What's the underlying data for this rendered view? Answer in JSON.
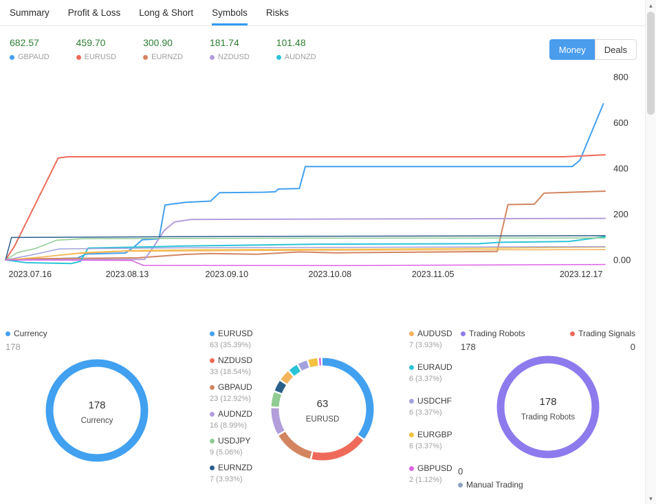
{
  "tabs": {
    "items": [
      {
        "label": "Summary",
        "active": false
      },
      {
        "label": "Profit & Loss",
        "active": false
      },
      {
        "label": "Long & Short",
        "active": false
      },
      {
        "label": "Symbols",
        "active": true
      },
      {
        "label": "Risks",
        "active": false
      }
    ]
  },
  "toolbar": {
    "money_label": "Money",
    "deals_label": "Deals",
    "active": "Money"
  },
  "top_legend": [
    {
      "value": "682.57",
      "label": "GBPAUD",
      "color": "#41a0f0"
    },
    {
      "value": "459.70",
      "label": "EURUSD",
      "color": "#ef6a5a"
    },
    {
      "value": "300.90",
      "label": "EURNZD",
      "color": "#d2855f"
    },
    {
      "value": "181.74",
      "label": "NZDUSD",
      "color": "#b39ddb"
    },
    {
      "value": "101.48",
      "label": "AUDNZD",
      "color": "#2bc3d7"
    }
  ],
  "colors": {
    "accent_blue": "#4a9ced",
    "positive_green": "#2e7d32",
    "tab_underline": "#2f9bf4"
  },
  "chart_data": [
    {
      "type": "line",
      "title": "Symbols cumulative profit (Money)",
      "legend_position": "top",
      "grid": false,
      "y_axis_position": "right",
      "y_range": [
        -60,
        820
      ],
      "y_ticks": [
        {
          "value": 800,
          "label": "800"
        },
        {
          "value": 600,
          "label": "600"
        },
        {
          "value": 400,
          "label": "400"
        },
        {
          "value": 200,
          "label": "200"
        },
        {
          "value": 0,
          "label": "0.00"
        }
      ],
      "x_tick_labels": [
        {
          "text": "2023.07.16",
          "frac": 0.041
        },
        {
          "text": "2023.08.13",
          "frac": 0.203
        },
        {
          "text": "2023.09.10",
          "frac": 0.369
        },
        {
          "text": "2023.10.08",
          "frac": 0.541
        },
        {
          "text": "2023.11.05",
          "frac": 0.713
        },
        {
          "text": "2023.12.17",
          "frac": 0.96
        }
      ],
      "series": [
        {
          "name": "GBPAUD",
          "color": "#41a0f0",
          "width": 2,
          "final": 682.57,
          "points": [
            [
              0,
              0
            ],
            [
              0.05,
              3
            ],
            [
              0.12,
              8
            ],
            [
              0.135,
              26
            ],
            [
              0.2,
              30
            ],
            [
              0.215,
              58
            ],
            [
              0.228,
              88
            ],
            [
              0.256,
              92
            ],
            [
              0.266,
              240
            ],
            [
              0.3,
              252
            ],
            [
              0.342,
              257
            ],
            [
              0.357,
              294
            ],
            [
              0.43,
              296
            ],
            [
              0.45,
              298
            ],
            [
              0.455,
              310
            ],
            [
              0.49,
              312
            ],
            [
              0.5,
              408
            ],
            [
              0.945,
              408
            ],
            [
              0.958,
              436
            ],
            [
              0.997,
              682.57
            ]
          ]
        },
        {
          "name": "EURUSD",
          "color": "#ef6a5a",
          "width": 2,
          "final": 459.7,
          "points": [
            [
              0,
              0
            ],
            [
              0.015,
              60
            ],
            [
              0.088,
              446
            ],
            [
              0.105,
              451
            ],
            [
              0.93,
              451
            ],
            [
              1.0,
              459.7
            ]
          ]
        },
        {
          "name": "EURNZD",
          "color": "#d2855f",
          "width": 2,
          "final": 300.9,
          "points": [
            [
              0,
              0
            ],
            [
              0.05,
              5
            ],
            [
              0.22,
              9
            ],
            [
              0.3,
              24
            ],
            [
              0.34,
              28
            ],
            [
              0.42,
              25
            ],
            [
              0.49,
              35
            ],
            [
              0.55,
              31
            ],
            [
              0.82,
              37
            ],
            [
              0.838,
              242
            ],
            [
              0.882,
              244
            ],
            [
              0.898,
              292
            ],
            [
              1.0,
              300.9
            ]
          ]
        },
        {
          "name": "NZDUSD",
          "color": "#b39ddb",
          "width": 2,
          "final": 181.74,
          "points": [
            [
              0,
              0
            ],
            [
              0.232,
              2
            ],
            [
              0.248,
              62
            ],
            [
              0.265,
              130
            ],
            [
              0.282,
              166
            ],
            [
              0.31,
              177
            ],
            [
              1.0,
              181.74
            ]
          ]
        },
        {
          "name": "AUDNZD",
          "color": "#2bc3d7",
          "width": 2,
          "final": 101.48,
          "points": [
            [
              0,
              0
            ],
            [
              0.035,
              -12
            ],
            [
              0.11,
              -16
            ],
            [
              0.125,
              -6
            ],
            [
              0.138,
              52
            ],
            [
              0.24,
              57
            ],
            [
              0.3,
              61
            ],
            [
              0.42,
              65
            ],
            [
              0.52,
              69
            ],
            [
              0.79,
              71
            ],
            [
              0.825,
              77
            ],
            [
              0.94,
              81
            ],
            [
              1.0,
              101.48
            ]
          ]
        },
        {
          "name": "USDJPY",
          "color": "#8fcb92",
          "width": 1.5,
          "final": 96,
          "points": [
            [
              0,
              0
            ],
            [
              0.02,
              32
            ],
            [
              0.05,
              50
            ],
            [
              0.085,
              86
            ],
            [
              0.13,
              93
            ],
            [
              0.5,
              95
            ],
            [
              1.0,
              96
            ]
          ]
        },
        {
          "name": "EURAUD",
          "color": "#2a5f8a",
          "width": 1.5,
          "final": 106,
          "points": [
            [
              0,
              0
            ],
            [
              0.01,
              98
            ],
            [
              0.4,
              103
            ],
            [
              1.0,
              106
            ]
          ]
        },
        {
          "name": "EURGBP",
          "color": "#f3c13e",
          "width": 1.5,
          "final": 56,
          "points": [
            [
              0,
              0
            ],
            [
              0.06,
              13
            ],
            [
              0.13,
              32
            ],
            [
              0.21,
              41
            ],
            [
              0.35,
              45
            ],
            [
              0.6,
              47
            ],
            [
              0.8,
              51
            ],
            [
              1.0,
              56
            ]
          ]
        },
        {
          "name": "USDCHF",
          "color": "#a3a2dd",
          "width": 1.5,
          "final": 58,
          "points": [
            [
              0,
              0
            ],
            [
              0.04,
              20
            ],
            [
              0.09,
              48
            ],
            [
              0.3,
              53
            ],
            [
              0.7,
              56
            ],
            [
              1.0,
              58
            ]
          ]
        },
        {
          "name": "AUDUSD",
          "color": "#f5b35c",
          "width": 1.5,
          "final": 45,
          "points": [
            [
              0,
              0
            ],
            [
              0.05,
              10
            ],
            [
              0.12,
              28
            ],
            [
              0.2,
              38
            ],
            [
              0.5,
              42
            ],
            [
              1.0,
              45
            ]
          ]
        },
        {
          "name": "GBPUSD",
          "color": "#dd63e6",
          "width": 1.5,
          "final": -20,
          "points": [
            [
              0,
              0
            ],
            [
              0.21,
              -2
            ],
            [
              0.23,
              -24
            ],
            [
              0.55,
              -25
            ],
            [
              1.0,
              -20
            ]
          ]
        }
      ]
    },
    {
      "type": "pie",
      "variant": "donut",
      "center_value": "178",
      "center_label": "Currency",
      "slices": [
        {
          "label": "Currency",
          "value": 178,
          "pct": 100,
          "color": "#41a0f0"
        }
      ]
    },
    {
      "type": "pie",
      "variant": "donut",
      "center_value": "63",
      "center_label": "EURUSD",
      "slices": [
        {
          "label": "EURUSD",
          "value": 63,
          "pct": 35.39,
          "color": "#41a0f0"
        },
        {
          "label": "NZDUSD",
          "value": 33,
          "pct": 18.54,
          "color": "#ef6a5a"
        },
        {
          "label": "GBPAUD",
          "value": 23,
          "pct": 12.92,
          "color": "#d2855f"
        },
        {
          "label": "AUDNZD",
          "value": 16,
          "pct": 8.99,
          "color": "#b39ddb"
        },
        {
          "label": "USDJPY",
          "value": 9,
          "pct": 5.06,
          "color": "#8fcb92"
        },
        {
          "label": "EURNZD",
          "value": 7,
          "pct": 3.93,
          "color": "#2a5f8a"
        },
        {
          "label": "AUDUSD",
          "value": 7,
          "pct": 3.93,
          "color": "#f5b35c"
        },
        {
          "label": "EURAUD",
          "value": 6,
          "pct": 3.37,
          "color": "#2bc3d7"
        },
        {
          "label": "USDCHF",
          "value": 6,
          "pct": 3.37,
          "color": "#a3a2dd"
        },
        {
          "label": "EURGBP",
          "value": 6,
          "pct": 3.37,
          "color": "#f3c13e"
        },
        {
          "label": "GBPUSD",
          "value": 2,
          "pct": 1.12,
          "color": "#dd63e6"
        }
      ]
    },
    {
      "type": "pie",
      "variant": "donut",
      "center_value": "178",
      "center_label": "Trading Robots",
      "slices": [
        {
          "label": "Trading Robots",
          "value": 178,
          "pct": 100,
          "color": "#8d7bed"
        },
        {
          "label": "Trading Signals",
          "value": 0,
          "pct": 0,
          "color": "#ef6a5a"
        },
        {
          "label": "Manual Trading",
          "value": 0,
          "pct": 0,
          "color": "#8fa3c0"
        }
      ]
    }
  ],
  "bottom_legends": {
    "currency": {
      "label": "Currency",
      "value": "178",
      "color": "#41a0f0"
    },
    "symbols_col1": [
      {
        "label": "EURUSD",
        "detail": "63 (35.39%)",
        "color": "#41a0f0"
      },
      {
        "label": "NZDUSD",
        "detail": "33 (18.54%)",
        "color": "#ef6a5a"
      },
      {
        "label": "GBPAUD",
        "detail": "23 (12.92%)",
        "color": "#d2855f"
      },
      {
        "label": "AUDNZD",
        "detail": "16 (8.99%)",
        "color": "#b39ddb"
      },
      {
        "label": "USDJPY",
        "detail": "9 (5.06%)",
        "color": "#8fcb92"
      },
      {
        "label": "EURNZD",
        "detail": "7 (3.93%)",
        "color": "#2a5f8a"
      }
    ],
    "symbols_col2": [
      {
        "label": "AUDUSD",
        "detail": "7 (3.93%)",
        "color": "#f5b35c"
      },
      {
        "label": "EURAUD",
        "detail": "6 (3.37%)",
        "color": "#2bc3d7"
      },
      {
        "label": "USDCHF",
        "detail": "6 (3.37%)",
        "color": "#a3a2dd"
      },
      {
        "label": "EURGBP",
        "detail": "6 (3.37%)",
        "color": "#f3c13e"
      },
      {
        "label": "GBPUSD",
        "detail": "2 (1.12%)",
        "color": "#dd63e6"
      }
    ],
    "trading_robots": {
      "label": "Trading Robots",
      "value": "178",
      "color": "#8d7bed"
    },
    "trading_signals": {
      "label": "Trading Signals",
      "value": "0",
      "color": "#ef6a5a"
    },
    "manual_trading": {
      "label": "Manual Trading",
      "value": "0",
      "color": "#8fa3c0"
    }
  }
}
